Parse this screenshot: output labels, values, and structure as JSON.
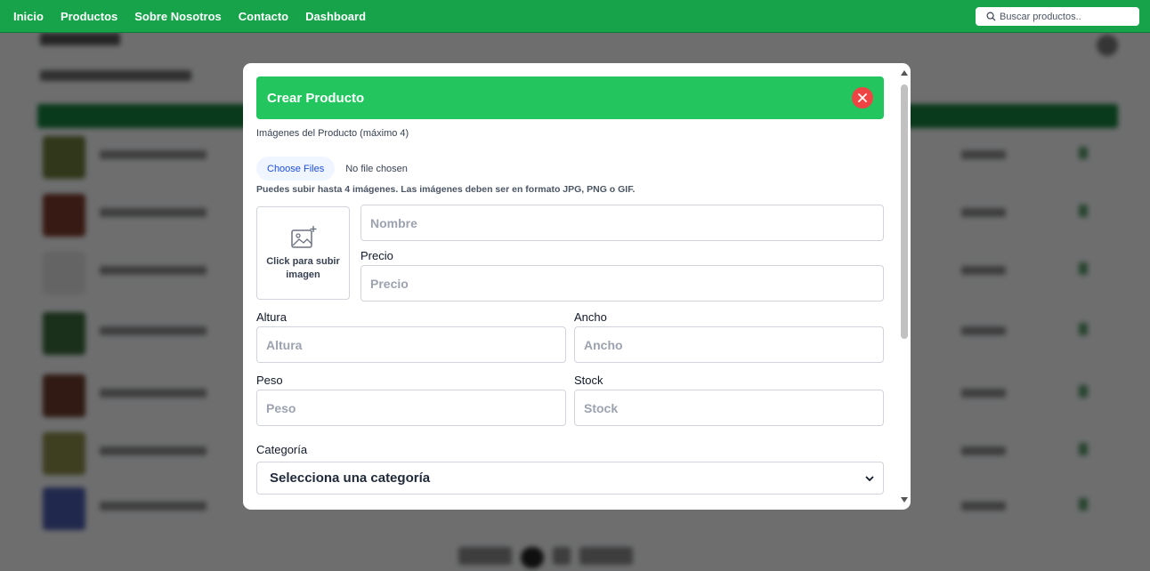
{
  "nav": {
    "links": [
      "Inicio",
      "Productos",
      "Sobre Nosotros",
      "Contacto",
      "Dashboard"
    ],
    "search_placeholder": "Buscar productos.."
  },
  "modal": {
    "title": "Crear Producto",
    "images_label": "Imágenes del Producto (máximo 4)",
    "choose_files_label": "Choose Files",
    "file_status": "No file chosen",
    "help_text": "Puedes subir hasta 4 imágenes. Las imágenes deben ser en formato JPG, PNG o GIF.",
    "upload_text": "Click para subir imagen",
    "fields": {
      "nombre_placeholder": "Nombre",
      "precio_label": "Precio",
      "precio_placeholder": "Precio",
      "altura_label": "Altura",
      "altura_placeholder": "Altura",
      "ancho_label": "Ancho",
      "ancho_placeholder": "Ancho",
      "peso_label": "Peso",
      "peso_placeholder": "Peso",
      "stock_label": "Stock",
      "stock_placeholder": "Stock"
    },
    "categoria_label": "Categoría",
    "categoria_value": "Selecciona una categoría"
  },
  "colors": {
    "nav_green": "#16a34a",
    "header_green": "#22c55e",
    "close_red": "#ef4444"
  },
  "icons": [
    "search-icon",
    "close-icon",
    "image-add-icon",
    "chevron-down-icon"
  ]
}
